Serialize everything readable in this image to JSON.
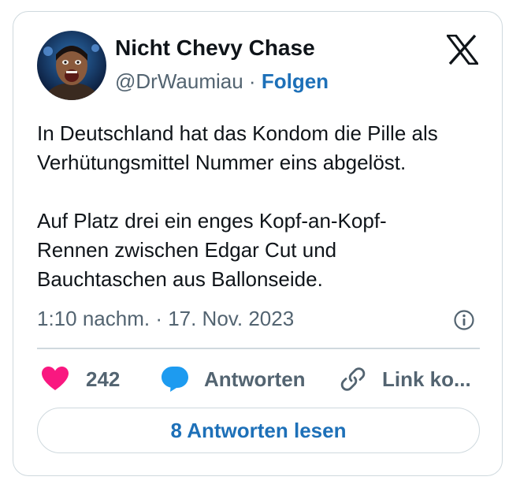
{
  "author": {
    "name": "Nicht Chevy Chase",
    "handle": "@DrWaumiau",
    "separator": "·",
    "follow_label": "Folgen"
  },
  "tweet": {
    "paragraphs": [
      "In Deutschland hat das Kondom die Pille als\nVerhütungsmittel Nummer eins abgelöst.",
      "Auf Platz drei ein enges Kopf-an-Kopf-\nRennen zwischen Edgar Cut und\nBauchtaschen aus Ballonseide."
    ],
    "timestamp": "1:10 nachm. · 17. Nov. 2023"
  },
  "actions": {
    "like_count": "242",
    "reply_label": "Antworten",
    "copy_link_label": "Link ko..."
  },
  "read_replies_label": "8 Antworten lesen",
  "icons": {
    "logo": "x-logo-icon",
    "info": "info-icon",
    "like": "heart-icon",
    "reply": "speech-bubble-icon",
    "link": "link-icon"
  },
  "colors": {
    "link_blue": "#1d70b8",
    "heart": "#f91880",
    "reply_blue": "#1d9bf0",
    "secondary_text": "#536471",
    "border": "#cfd9de"
  }
}
